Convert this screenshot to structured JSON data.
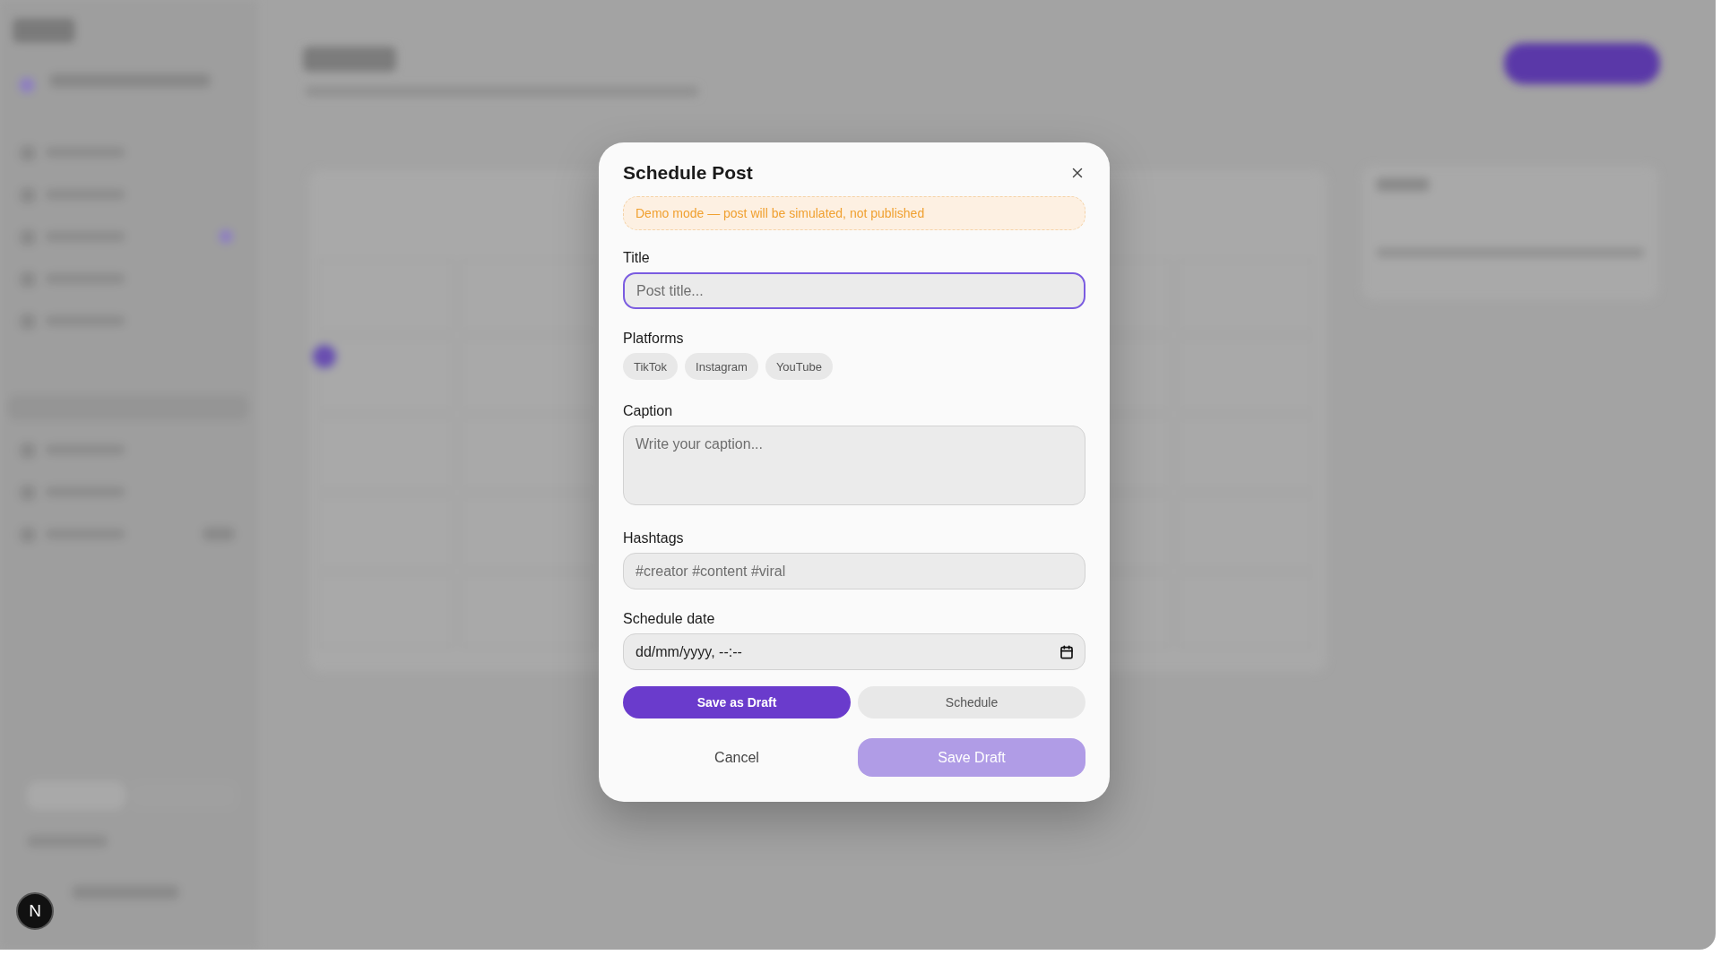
{
  "dialog": {
    "title": "Schedule Post",
    "notice": "Demo mode — post will be simulated, not published",
    "fields": [
      {
        "kind": "input",
        "label": "Title",
        "placeholder": "Post title...",
        "focused": true
      },
      {
        "kind": "chips",
        "label": "Platforms",
        "options": [
          {
            "label": "TikTok",
            "selected": false
          },
          {
            "label": "Instagram",
            "selected": false
          },
          {
            "label": "YouTube",
            "selected": false
          }
        ]
      },
      {
        "kind": "textarea",
        "label": "Caption",
        "placeholder": "Write your caption...",
        "focused": false
      },
      {
        "kind": "input",
        "label": "Hashtags",
        "placeholder": "#creator #content #viral",
        "focused": false
      },
      {
        "kind": "date",
        "label": "Schedule date",
        "value": "dd/mm/yyyy, --:--",
        "focused": false
      }
    ],
    "modes": [
      {
        "label": "Save as Draft",
        "selected": true
      },
      {
        "label": "Schedule",
        "selected": false
      }
    ],
    "cancel": "Cancel",
    "submit": {
      "label": "Save Draft",
      "disabled": true
    }
  },
  "dev_badge": {
    "label": "N"
  }
}
